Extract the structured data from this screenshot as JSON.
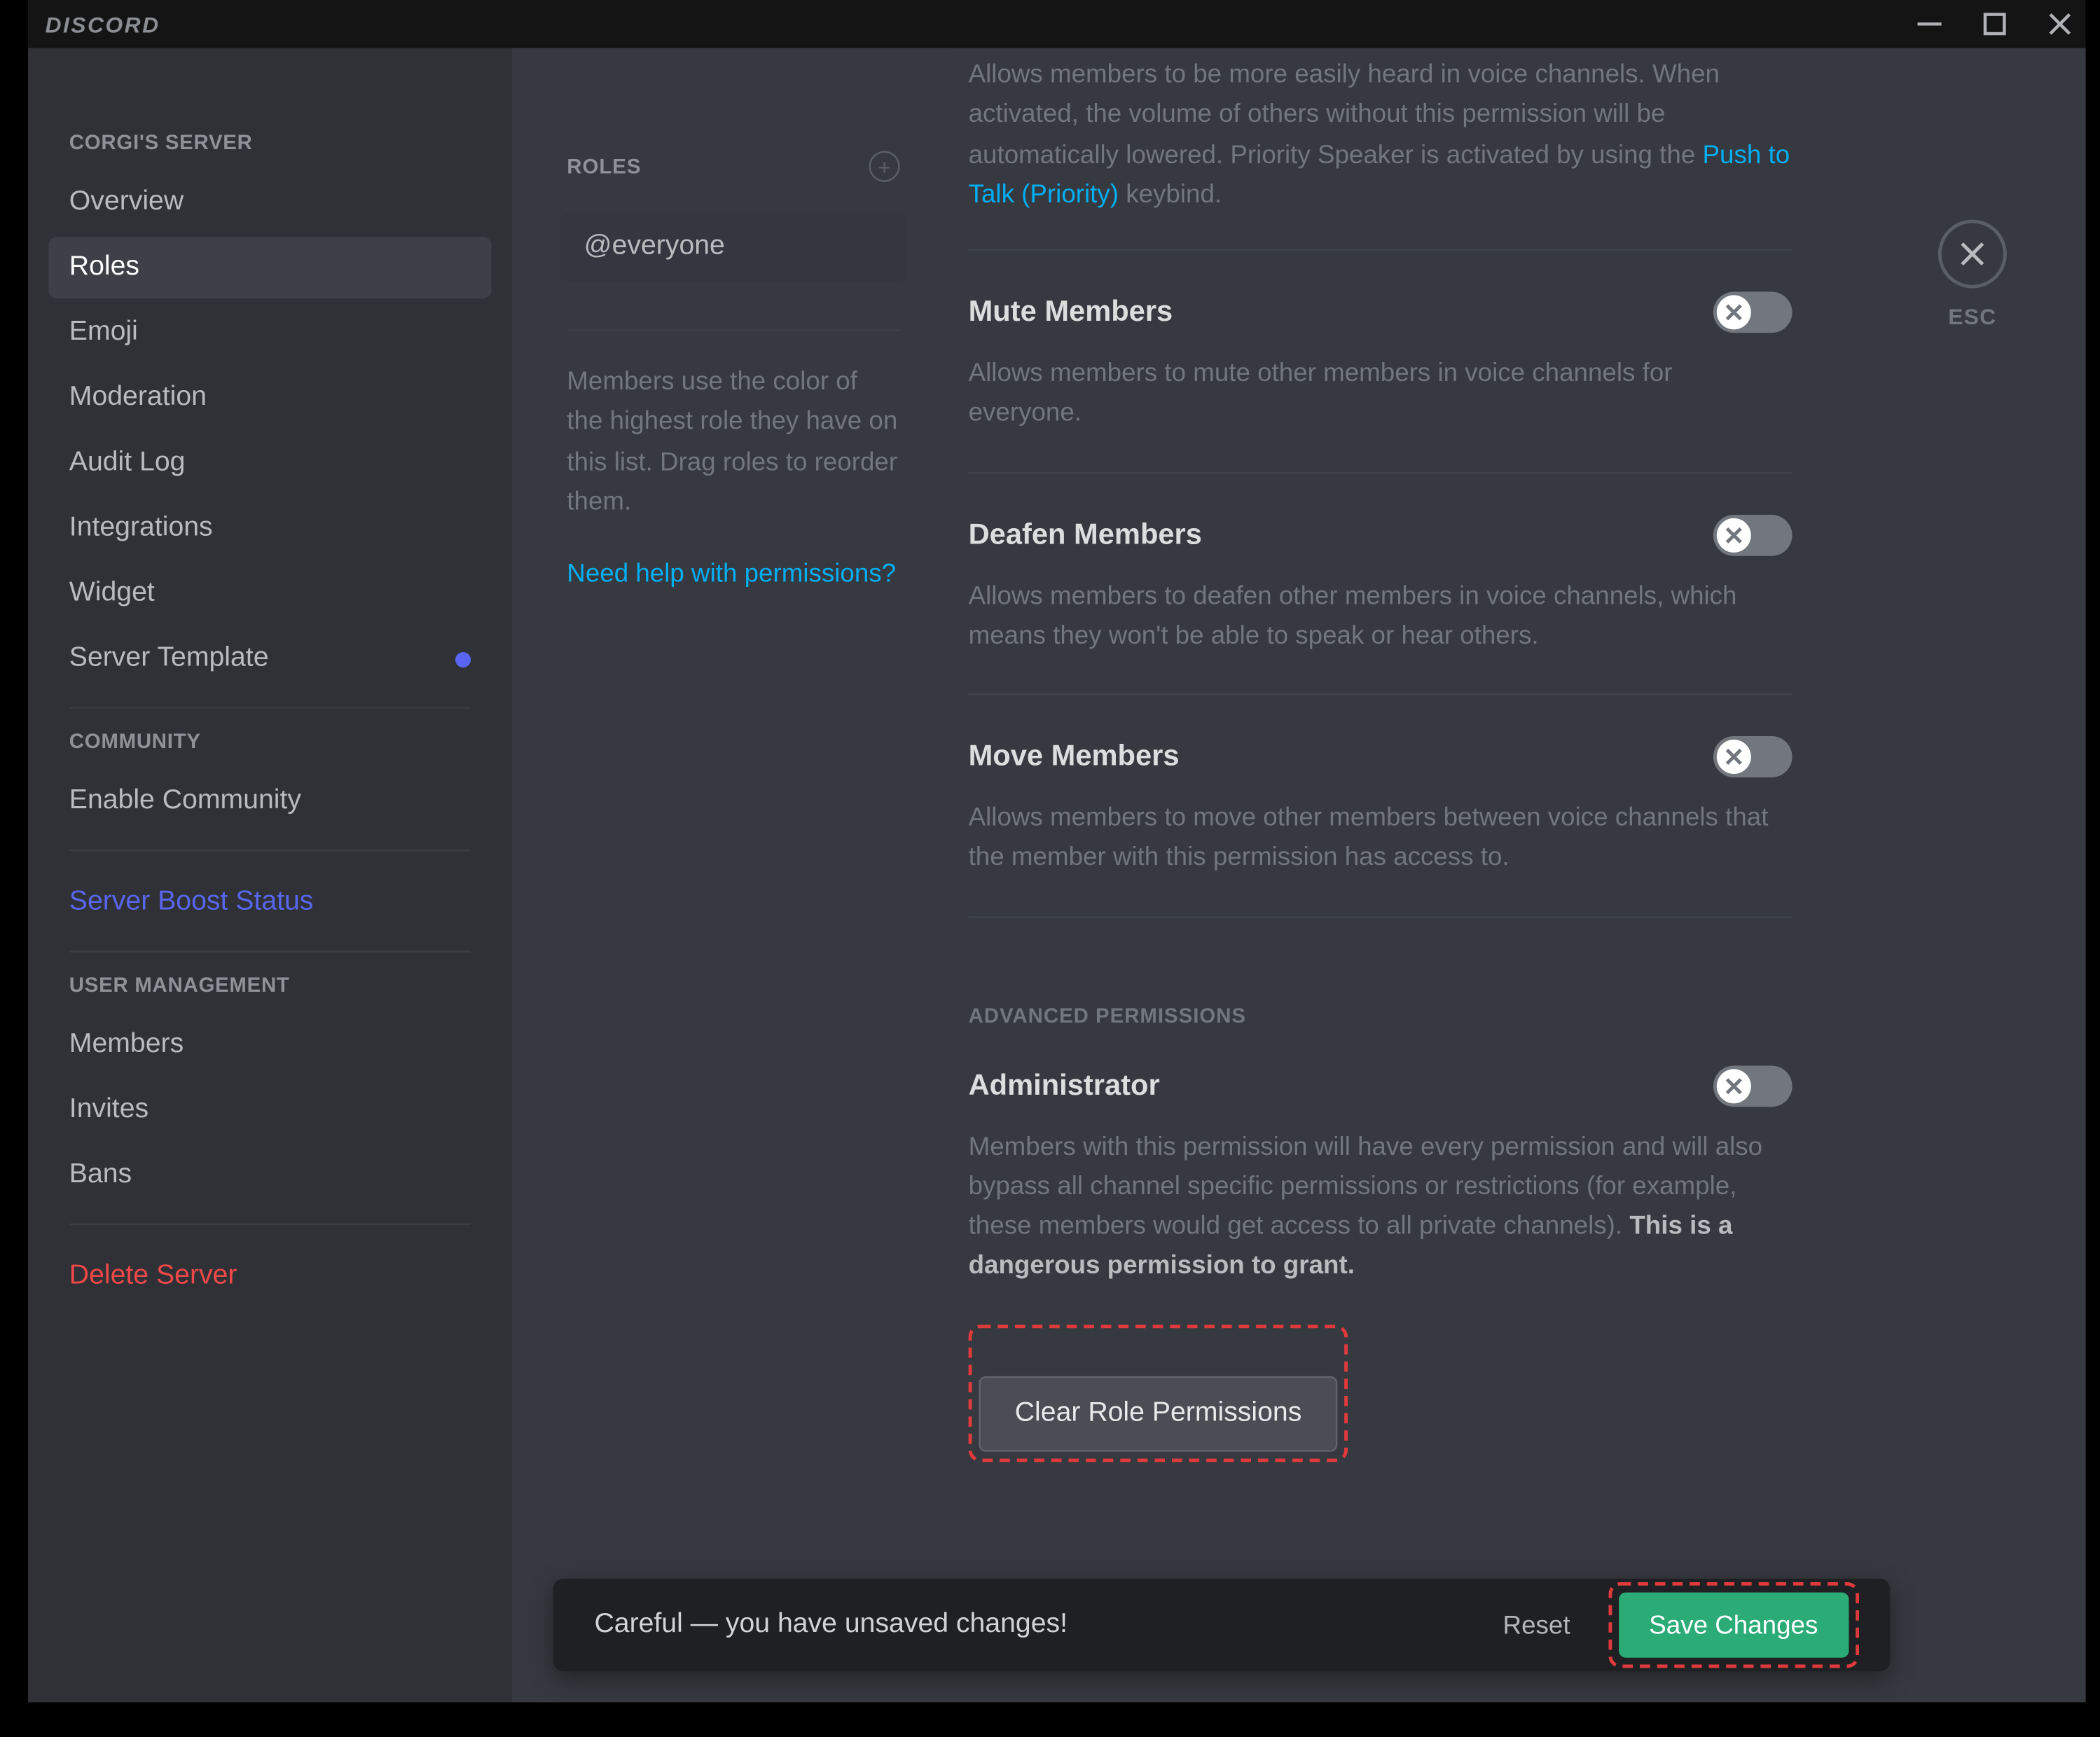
{
  "title_bar": {
    "brand": "DISCORD"
  },
  "sidebar": {
    "server_name": "CORGI'S SERVER",
    "items": [
      {
        "label": "Overview"
      },
      {
        "label": "Roles"
      },
      {
        "label": "Emoji"
      },
      {
        "label": "Moderation"
      },
      {
        "label": "Audit Log"
      },
      {
        "label": "Integrations"
      },
      {
        "label": "Widget"
      },
      {
        "label": "Server Template"
      }
    ],
    "community_header": "COMMUNITY",
    "community_item": "Enable Community",
    "boost": "Server Boost Status",
    "user_mgmt_header": "USER MANAGEMENT",
    "user_items": [
      {
        "label": "Members"
      },
      {
        "label": "Invites"
      },
      {
        "label": "Bans"
      }
    ],
    "delete": "Delete Server"
  },
  "roles_panel": {
    "header": "ROLES",
    "selected_role": "@everyone",
    "help_text": "Members use the color of the highest role they have on this list. Drag roles to reorder them.",
    "help_link": "Need help with permissions?"
  },
  "permissions": {
    "priority_desc_prefix": "Allows members to be more easily heard in voice channels. When activated, the volume of others without this permission will be automatically lowered. Priority Speaker is activated by using the ",
    "priority_link": "Push to Talk (Priority)",
    "priority_desc_suffix": " keybind.",
    "items": [
      {
        "title": "Mute Members",
        "desc": "Allows members to mute other members in voice channels for everyone."
      },
      {
        "title": "Deafen Members",
        "desc": "Allows members to deafen other members in voice channels, which means they won't be able to speak or hear others."
      },
      {
        "title": "Move Members",
        "desc": "Allows members to move other members between voice channels that the member with this permission has access to."
      }
    ],
    "advanced_header": "ADVANCED PERMISSIONS",
    "admin": {
      "title": "Administrator",
      "desc": "Members with this permission will have every permission and will also bypass all channel specific permissions or restrictions (for example, these members would get access to all private channels). ",
      "warn": "This is a dangerous permission to grant."
    },
    "clear_button": "Clear Role Permissions"
  },
  "savebar": {
    "message": "Careful — you have unsaved changes!",
    "reset": "Reset",
    "save": "Save Changes"
  },
  "close": {
    "esc": "ESC"
  }
}
